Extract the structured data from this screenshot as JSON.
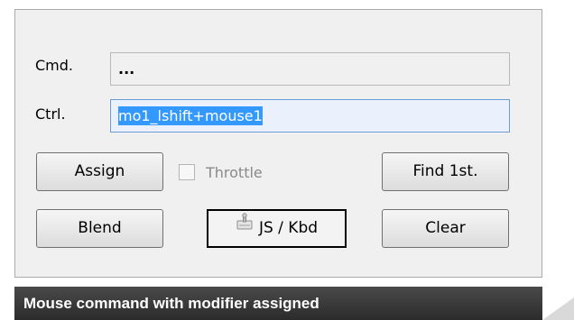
{
  "dialog": {
    "cmd_label": "Cmd.",
    "cmd_value": "...",
    "ctrl_label": "Ctrl.",
    "ctrl_value": "mo1_lshift+mouse1",
    "buttons": {
      "assign": "Assign",
      "find_first": "Find 1st.",
      "blend": "Blend",
      "js_kbd": "JS / Kbd",
      "clear": "Clear"
    },
    "throttle_label": "Throttle",
    "throttle_checked": false,
    "throttle_enabled": false
  },
  "caption": {
    "text": "Mouse command with modifier assigned"
  },
  "icons": {
    "js_kbd": "joystick-keyboard-icon"
  },
  "colors": {
    "selection": "#3399ff",
    "active_field_bg": "#eaf0fc",
    "caption_bg": "#333333"
  }
}
